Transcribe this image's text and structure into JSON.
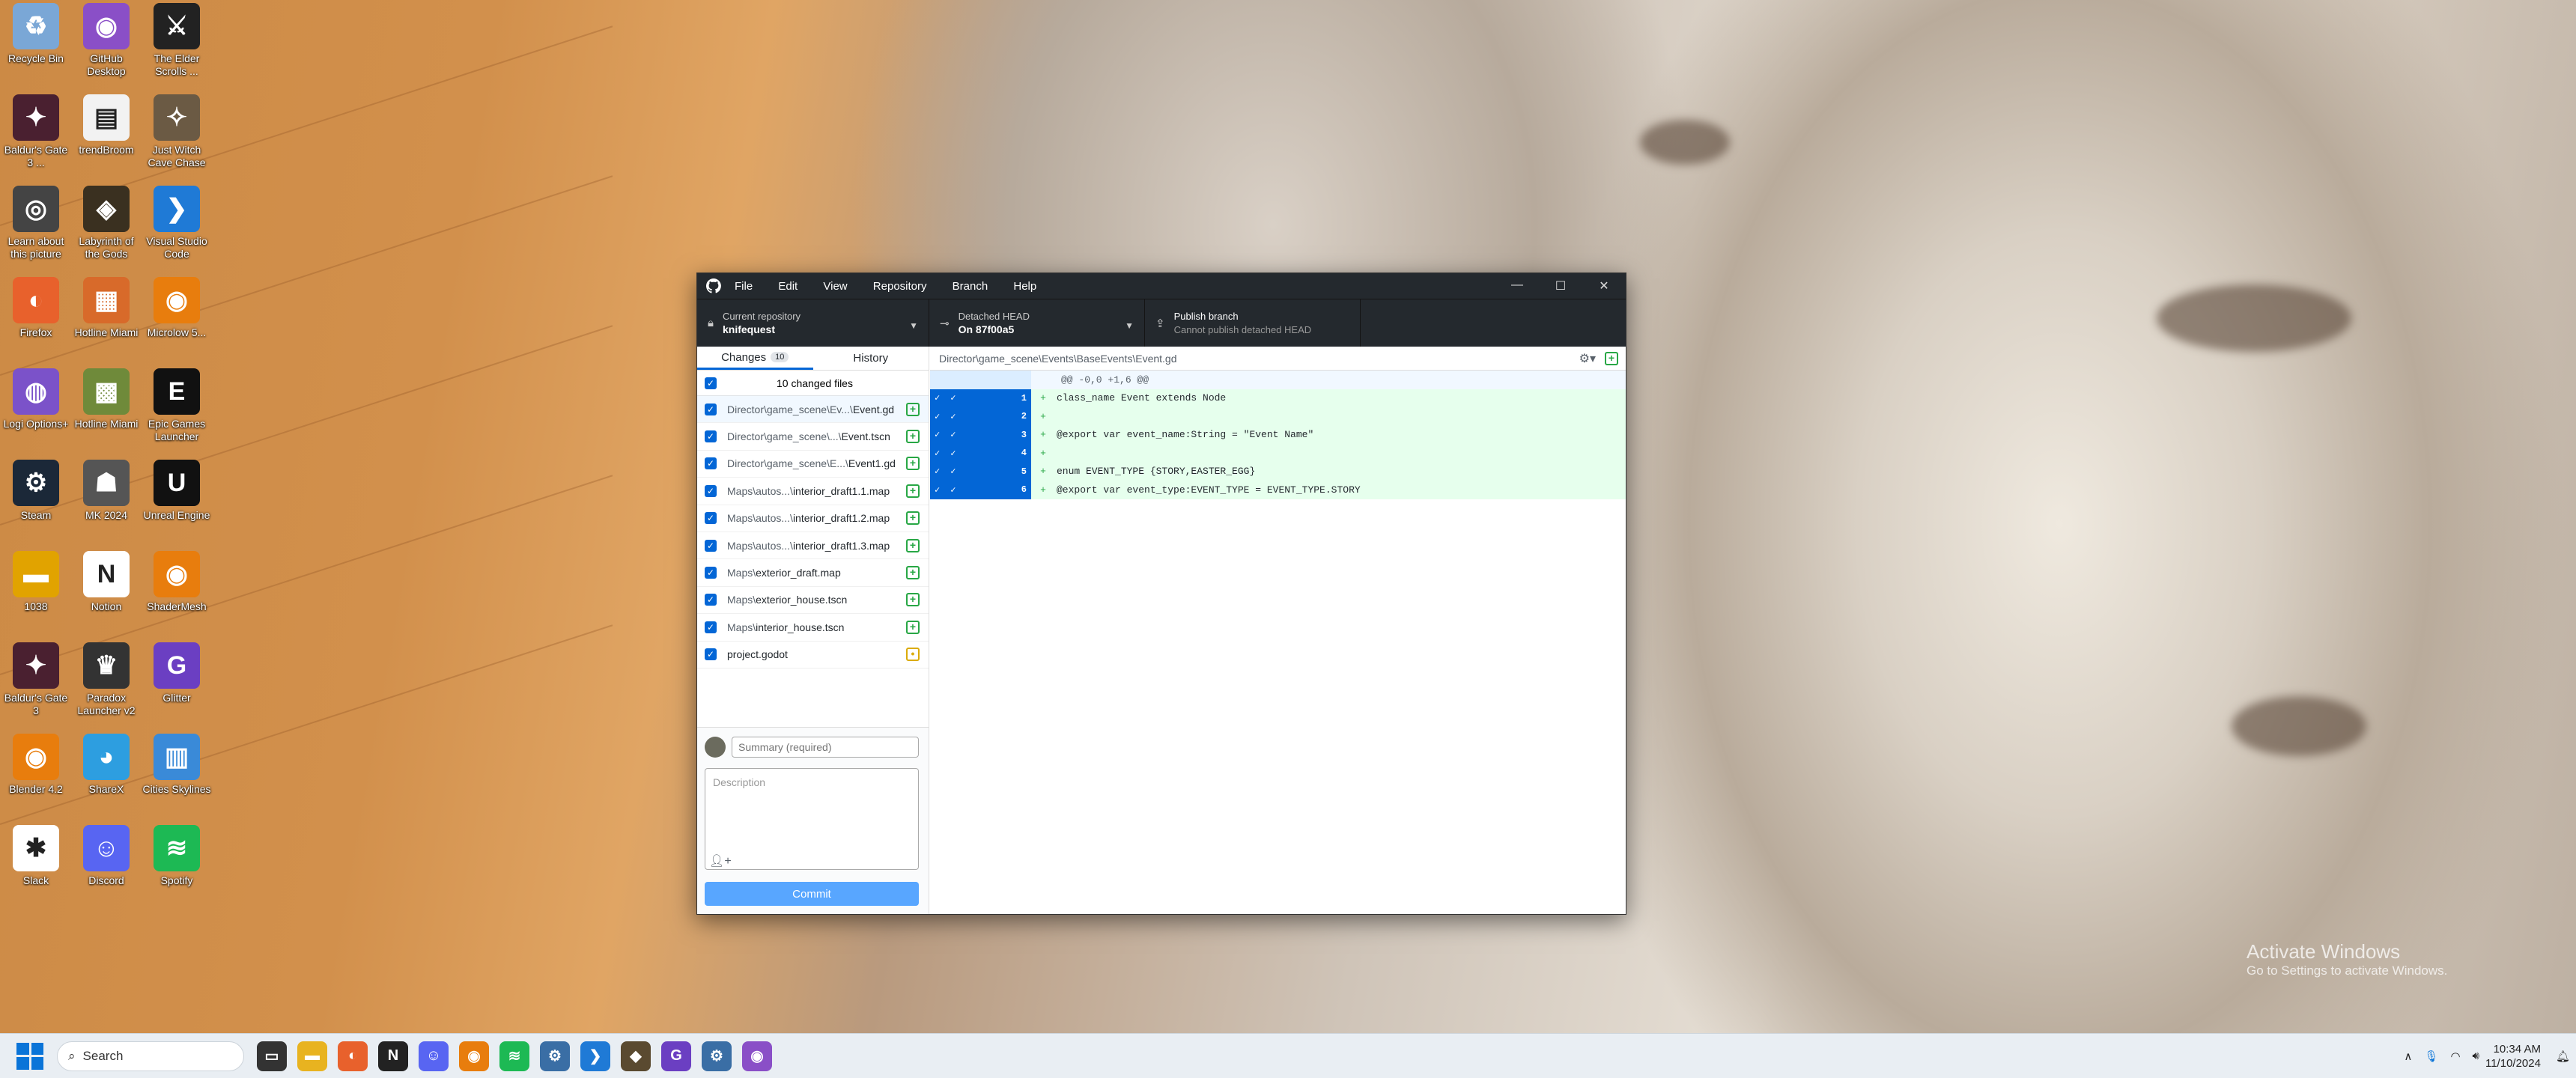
{
  "desktop_icons": [
    {
      "label": "Recycle Bin",
      "icon": "recycle-bin-icon",
      "color": "#7aa7d6",
      "glyph": "♻"
    },
    {
      "label": "GitHub Desktop",
      "icon": "github-desktop-icon",
      "color": "#8a4fc7",
      "glyph": "◉"
    },
    {
      "label": "The Elder Scrolls ...",
      "icon": "elder-scrolls-icon",
      "color": "#222222",
      "glyph": "⚔"
    },
    {
      "label": "Baldur's Gate 3 ...",
      "icon": "baldurs-gate-icon",
      "color": "#4a2030",
      "glyph": "✦"
    },
    {
      "label": "trendBroom",
      "icon": "document-icon",
      "color": "#f2f2f2",
      "glyph": "▤"
    },
    {
      "label": "Just Witch Cave Chase",
      "icon": "game-icon",
      "color": "#6b5a44",
      "glyph": "✧"
    },
    {
      "label": "Learn about this picture",
      "icon": "camera-icon",
      "color": "#444444",
      "glyph": "◎"
    },
    {
      "label": "Labyrinth of the Gods",
      "icon": "game-icon",
      "color": "#3a3020",
      "glyph": "◈"
    },
    {
      "label": "Visual Studio Code",
      "icon": "vscode-icon",
      "color": "#1f7ad6",
      "glyph": "❯"
    },
    {
      "label": "Firefox",
      "icon": "firefox-icon",
      "color": "#e8612c",
      "glyph": "◐"
    },
    {
      "label": "Hotline Miami",
      "icon": "hotline-miami-icon",
      "color": "#d86a2a",
      "glyph": "▦"
    },
    {
      "label": "Microlow 5...",
      "icon": "blender-icon",
      "color": "#e87d0d",
      "glyph": "◉"
    },
    {
      "label": "Logi Options+",
      "icon": "logi-icon",
      "color": "#7b52c9",
      "glyph": "◍"
    },
    {
      "label": "Hotline Miami",
      "icon": "minecraft-icon",
      "color": "#6f8a3a",
      "glyph": "▩"
    },
    {
      "label": "Epic Games Launcher",
      "icon": "epic-games-icon",
      "color": "#111111",
      "glyph": "E"
    },
    {
      "label": "Steam",
      "icon": "steam-icon",
      "color": "#1b2838",
      "glyph": "⚙"
    },
    {
      "label": "MK 2024",
      "icon": "game-icon",
      "color": "#555555",
      "glyph": "☗"
    },
    {
      "label": "Unreal Engine",
      "icon": "unreal-icon",
      "color": "#111111",
      "glyph": "U"
    },
    {
      "label": "1038",
      "icon": "folder-icon",
      "color": "#e1a300",
      "glyph": "▬"
    },
    {
      "label": "Notion",
      "icon": "notion-icon",
      "color": "#ffffff",
      "glyph": "N"
    },
    {
      "label": "ShaderMesh",
      "icon": "blender-icon",
      "color": "#e87d0d",
      "glyph": "◉"
    },
    {
      "label": "Baldur's Gate 3",
      "icon": "baldurs-gate-icon",
      "color": "#4a2030",
      "glyph": "✦"
    },
    {
      "label": "Paradox Launcher v2",
      "icon": "paradox-icon",
      "color": "#333333",
      "glyph": "♛"
    },
    {
      "label": "Glitter",
      "icon": "glitter-icon",
      "color": "#6b3fc2",
      "glyph": "G"
    },
    {
      "label": "Blender 4.2",
      "icon": "blender-icon",
      "color": "#e87d0d",
      "glyph": "◉"
    },
    {
      "label": "ShareX",
      "icon": "sharex-icon",
      "color": "#2d9ee0",
      "glyph": "◕"
    },
    {
      "label": "Cities Skylines",
      "icon": "cities-skylines-icon",
      "color": "#3a8ad8",
      "glyph": "▥"
    },
    {
      "label": "Slack",
      "icon": "slack-icon",
      "color": "#ffffff",
      "glyph": "✱"
    },
    {
      "label": "Discord",
      "icon": "discord-icon",
      "color": "#5865f2",
      "glyph": "☺"
    },
    {
      "label": "Spotify",
      "icon": "spotify-icon",
      "color": "#1db954",
      "glyph": "≋"
    }
  ],
  "window": {
    "menu": [
      "File",
      "Edit",
      "View",
      "Repository",
      "Branch",
      "Help"
    ],
    "repo": {
      "caption": "Current repository",
      "value": "knifequest"
    },
    "branch": {
      "caption": "Detached HEAD",
      "value": "On 87f00a5"
    },
    "publish": {
      "caption": "Publish branch",
      "value": "Cannot publish detached HEAD"
    },
    "tabs": {
      "changes": "Changes",
      "changes_count": "10",
      "history": "History"
    },
    "files_header": "10 changed files",
    "files": [
      {
        "dir": "Director\\game_scene\\Ev...\\",
        "name": "Event.gd",
        "status": "added"
      },
      {
        "dir": "Director\\game_scene\\...\\",
        "name": "Event.tscn",
        "status": "added"
      },
      {
        "dir": "Director\\game_scene\\E...\\",
        "name": "Event1.gd",
        "status": "added"
      },
      {
        "dir": "Maps\\autos...\\",
        "name": "interior_draft1.1.map",
        "status": "added"
      },
      {
        "dir": "Maps\\autos...\\",
        "name": "interior_draft1.2.map",
        "status": "added"
      },
      {
        "dir": "Maps\\autos...\\",
        "name": "interior_draft1.3.map",
        "status": "added"
      },
      {
        "dir": "Maps\\",
        "name": "exterior_draft.map",
        "status": "added"
      },
      {
        "dir": "Maps\\",
        "name": "exterior_house.tscn",
        "status": "added"
      },
      {
        "dir": "Maps\\",
        "name": "interior_house.tscn",
        "status": "added"
      },
      {
        "dir": "",
        "name": "project.godot",
        "status": "modified"
      }
    ],
    "summary_placeholder": "Summary (required)",
    "description_placeholder": "Description",
    "commit_label": "Commit",
    "diff_path": "Director\\game_scene\\Events\\BaseEvents\\Event.gd",
    "hunk_header": "@@ -0,0 +1,6 @@",
    "diff_lines": [
      {
        "num": "1",
        "text": "class_name Event extends Node"
      },
      {
        "num": "2",
        "text": ""
      },
      {
        "num": "3",
        "text": "@export var event_name:String = \"Event Name\""
      },
      {
        "num": "4",
        "text": ""
      },
      {
        "num": "5",
        "text": "enum EVENT_TYPE {STORY,EASTER_EGG}"
      },
      {
        "num": "6",
        "text": "@export var event_type:EVENT_TYPE = EVENT_TYPE.STORY"
      }
    ]
  },
  "taskbar": {
    "search_label": "Search",
    "apps": [
      {
        "icon": "task-view-icon",
        "color": "#333333",
        "glyph": "▭"
      },
      {
        "icon": "file-explorer-icon",
        "color": "#e8b320",
        "glyph": "▬"
      },
      {
        "icon": "firefox-icon",
        "color": "#e8612c",
        "glyph": "◐"
      },
      {
        "icon": "notion-icon",
        "color": "#222222",
        "glyph": "N"
      },
      {
        "icon": "discord-icon",
        "color": "#5865f2",
        "glyph": "☺"
      },
      {
        "icon": "blender-icon",
        "color": "#e87d0d",
        "glyph": "◉"
      },
      {
        "icon": "spotify-icon",
        "color": "#1db954",
        "glyph": "≋"
      },
      {
        "icon": "settings-icon",
        "color": "#3a6ea5",
        "glyph": "⚙"
      },
      {
        "icon": "vscode-icon",
        "color": "#1f7ad6",
        "glyph": "❯"
      },
      {
        "icon": "game-icon",
        "color": "#5a4a30",
        "glyph": "◆"
      },
      {
        "icon": "glitter-icon",
        "color": "#6b3fc2",
        "glyph": "G"
      },
      {
        "icon": "settings-icon",
        "color": "#3a6ea5",
        "glyph": "⚙"
      },
      {
        "icon": "github-desktop-icon",
        "color": "#8a4fc7",
        "glyph": "◉"
      }
    ],
    "time": "10:34 AM",
    "date": "11/10/2024"
  },
  "activate": {
    "title": "Activate Windows",
    "subtitle": "Go to Settings to activate Windows."
  }
}
